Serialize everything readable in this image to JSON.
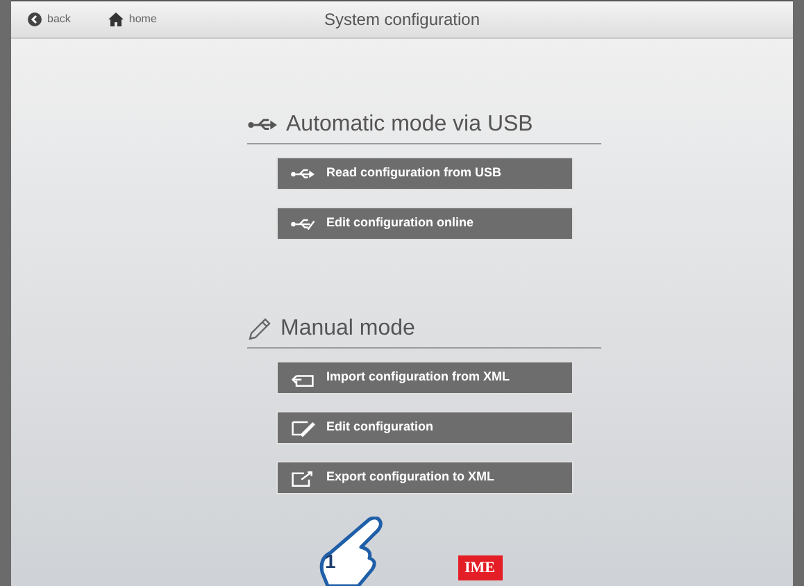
{
  "top_bar": {
    "back": "back",
    "home": "home",
    "title": "System configuration"
  },
  "sections": [
    {
      "kind": "usb",
      "title": "Automatic mode via USB",
      "buttons": [
        {
          "kind": "usb",
          "label": "Read configuration from USB"
        },
        {
          "kind": "usb-edit",
          "label": "Edit configuration online"
        }
      ]
    },
    {
      "kind": "manual",
      "title": "Manual mode",
      "buttons": [
        {
          "kind": "import",
          "label": "Import configuration from XML"
        },
        {
          "kind": "edit",
          "label": "Edit configuration"
        },
        {
          "kind": "export",
          "label": "Export configuration to XML"
        }
      ]
    }
  ],
  "logo": "IME",
  "callout": {
    "number": "1"
  }
}
